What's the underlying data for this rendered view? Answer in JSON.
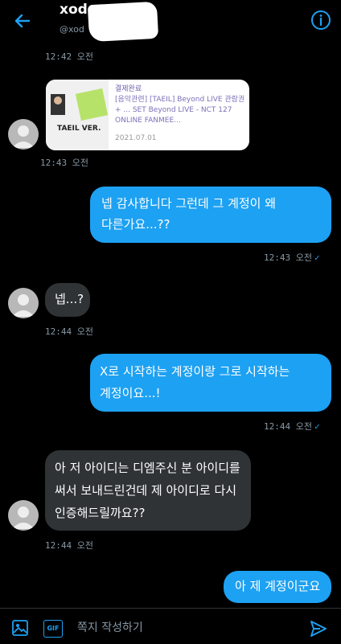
{
  "header": {
    "title": "xod",
    "handle": "@xod",
    "back_icon": "arrow-left-icon",
    "info_icon": "info-icon",
    "accent": "#1da1f2"
  },
  "messages": [
    {
      "type": "timestamp",
      "time": "12:42 오전"
    },
    {
      "type": "card",
      "status": "결제완료",
      "text": "[음악관련] [TAEIL] Beyond LIVE 관람권 + ... SET Beyond LIVE - NCT 127 ONLINE FANMEE...",
      "date": "2021.07.01",
      "thumb_label": "TAEIL VER."
    },
    {
      "type": "timestamp",
      "time": "12:43 오전"
    },
    {
      "type": "sent",
      "line1": "넵 감사합니다 그런데 그 계정이 왜",
      "line2": "다른가요...??",
      "time": "12:43 오전"
    },
    {
      "type": "received",
      "text": "넵...?",
      "time": "12:44 오전"
    },
    {
      "type": "sent",
      "line1": "X로 시작하는 계정이랑 그로 시작하는",
      "line2": "계정이요...!",
      "time": "12:44 오전"
    },
    {
      "type": "received",
      "line1": "아 저 아이디는 디엠주신 분 아이디를",
      "line2": "써서 보내드린건데 제 아이디로 다시",
      "line3": "인증해드릴까요??",
      "time": "12:44 오전"
    },
    {
      "type": "sent",
      "text": "아 제 계정이군요"
    }
  ],
  "composer": {
    "placeholder": "쪽지 작성하기",
    "gif_label": "GIF",
    "image_icon": "image-icon",
    "gif_icon": "gif-icon",
    "send_icon": "send-icon"
  },
  "colors": {
    "bubble_sent": "#1da1f2",
    "bubble_received": "#2f3336",
    "timestamp": "#8899a6",
    "background": "#000000"
  }
}
